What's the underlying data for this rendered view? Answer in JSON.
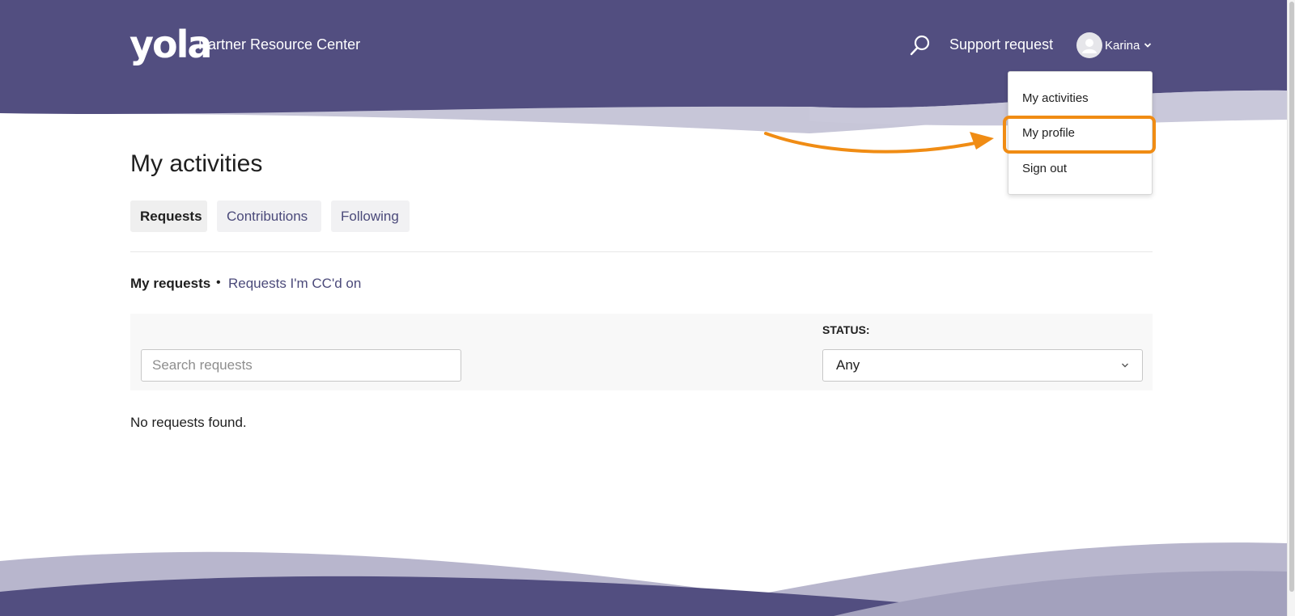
{
  "colors": {
    "brand": "#524e80",
    "accent": "#f08c14",
    "link": "#4b4a7a"
  },
  "header": {
    "logo_text": "yola",
    "brand_title": "Partner Resource Center",
    "search_icon": "search-icon",
    "support_label": "Support request",
    "user_name": "Karina"
  },
  "user_dropdown": {
    "items": [
      {
        "label": "My activities"
      },
      {
        "label": "My profile"
      },
      {
        "label": "Sign out"
      }
    ]
  },
  "main": {
    "title": "My activities",
    "tabs": [
      {
        "label": "Requests",
        "active": true
      },
      {
        "label": "Contributions",
        "active": false
      },
      {
        "label": "Following",
        "active": false
      }
    ],
    "subnav": {
      "active": "My requests",
      "separator": "•",
      "link": "Requests I'm CC'd on"
    },
    "filters": {
      "search_placeholder": "Search requests",
      "status_label": "STATUS:",
      "status_value": "Any"
    },
    "empty_message": "No requests found."
  }
}
